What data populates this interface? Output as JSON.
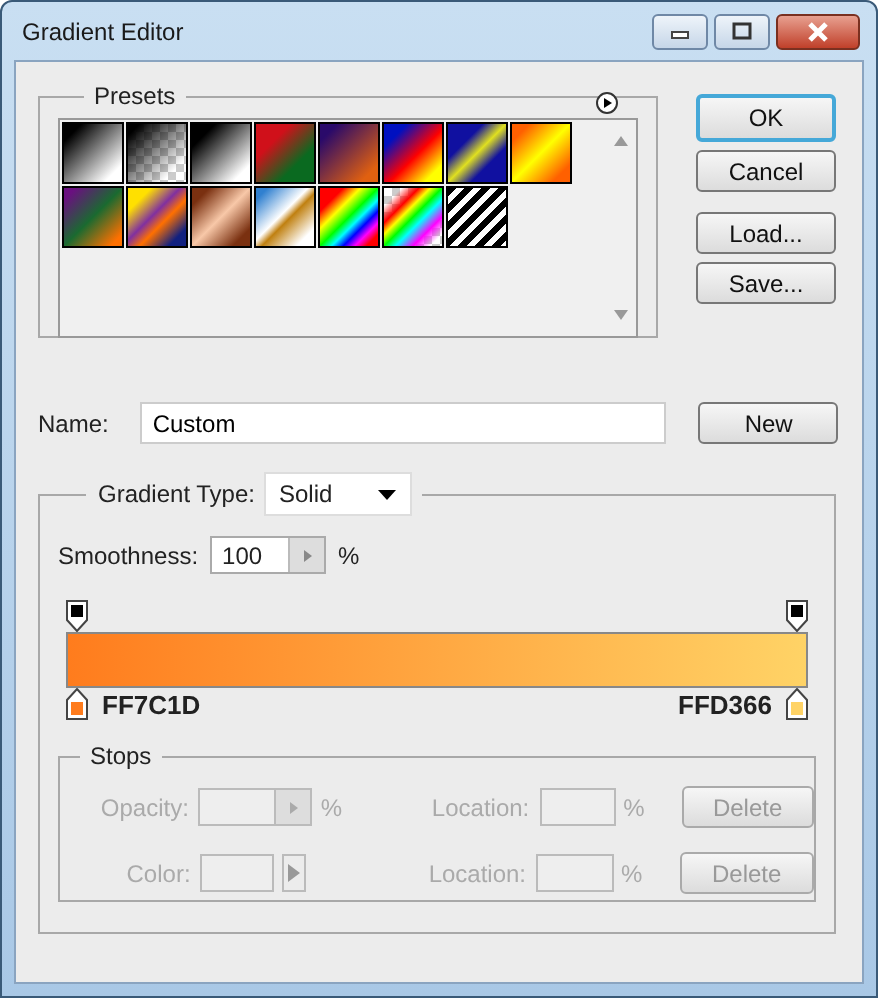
{
  "window": {
    "title": "Gradient Editor"
  },
  "presets": {
    "title": "Presets"
  },
  "buttons": [
    {
      "label": "OK",
      "default": true
    },
    {
      "label": "Cancel",
      "default": false
    },
    {
      "label": "Load...",
      "default": false
    },
    {
      "label": "Save...",
      "default": false
    }
  ],
  "name": {
    "label": "Name:",
    "value": "Custom",
    "button": "New"
  },
  "gradient": {
    "type_label": "Gradient Type:",
    "type_value": "Solid",
    "smoothness_label": "Smoothness:",
    "smoothness_value": "100",
    "smoothness_unit": "%"
  },
  "color_stops": [
    {
      "label": "FF7C1D",
      "color": "#ff7c1d"
    },
    {
      "label": "FFD366",
      "color": "#ffd366"
    }
  ],
  "stops": {
    "title": "Stops",
    "rows": [
      {
        "kind": "opacity",
        "label": "Opacity:",
        "unit": "%",
        "location_label": "Location:",
        "location_unit": "%",
        "button": "Delete",
        "disabled": true
      },
      {
        "kind": "color",
        "label": "Color:",
        "location_label": "Location:",
        "location_unit": "%",
        "button": "Delete",
        "disabled": true
      }
    ]
  }
}
